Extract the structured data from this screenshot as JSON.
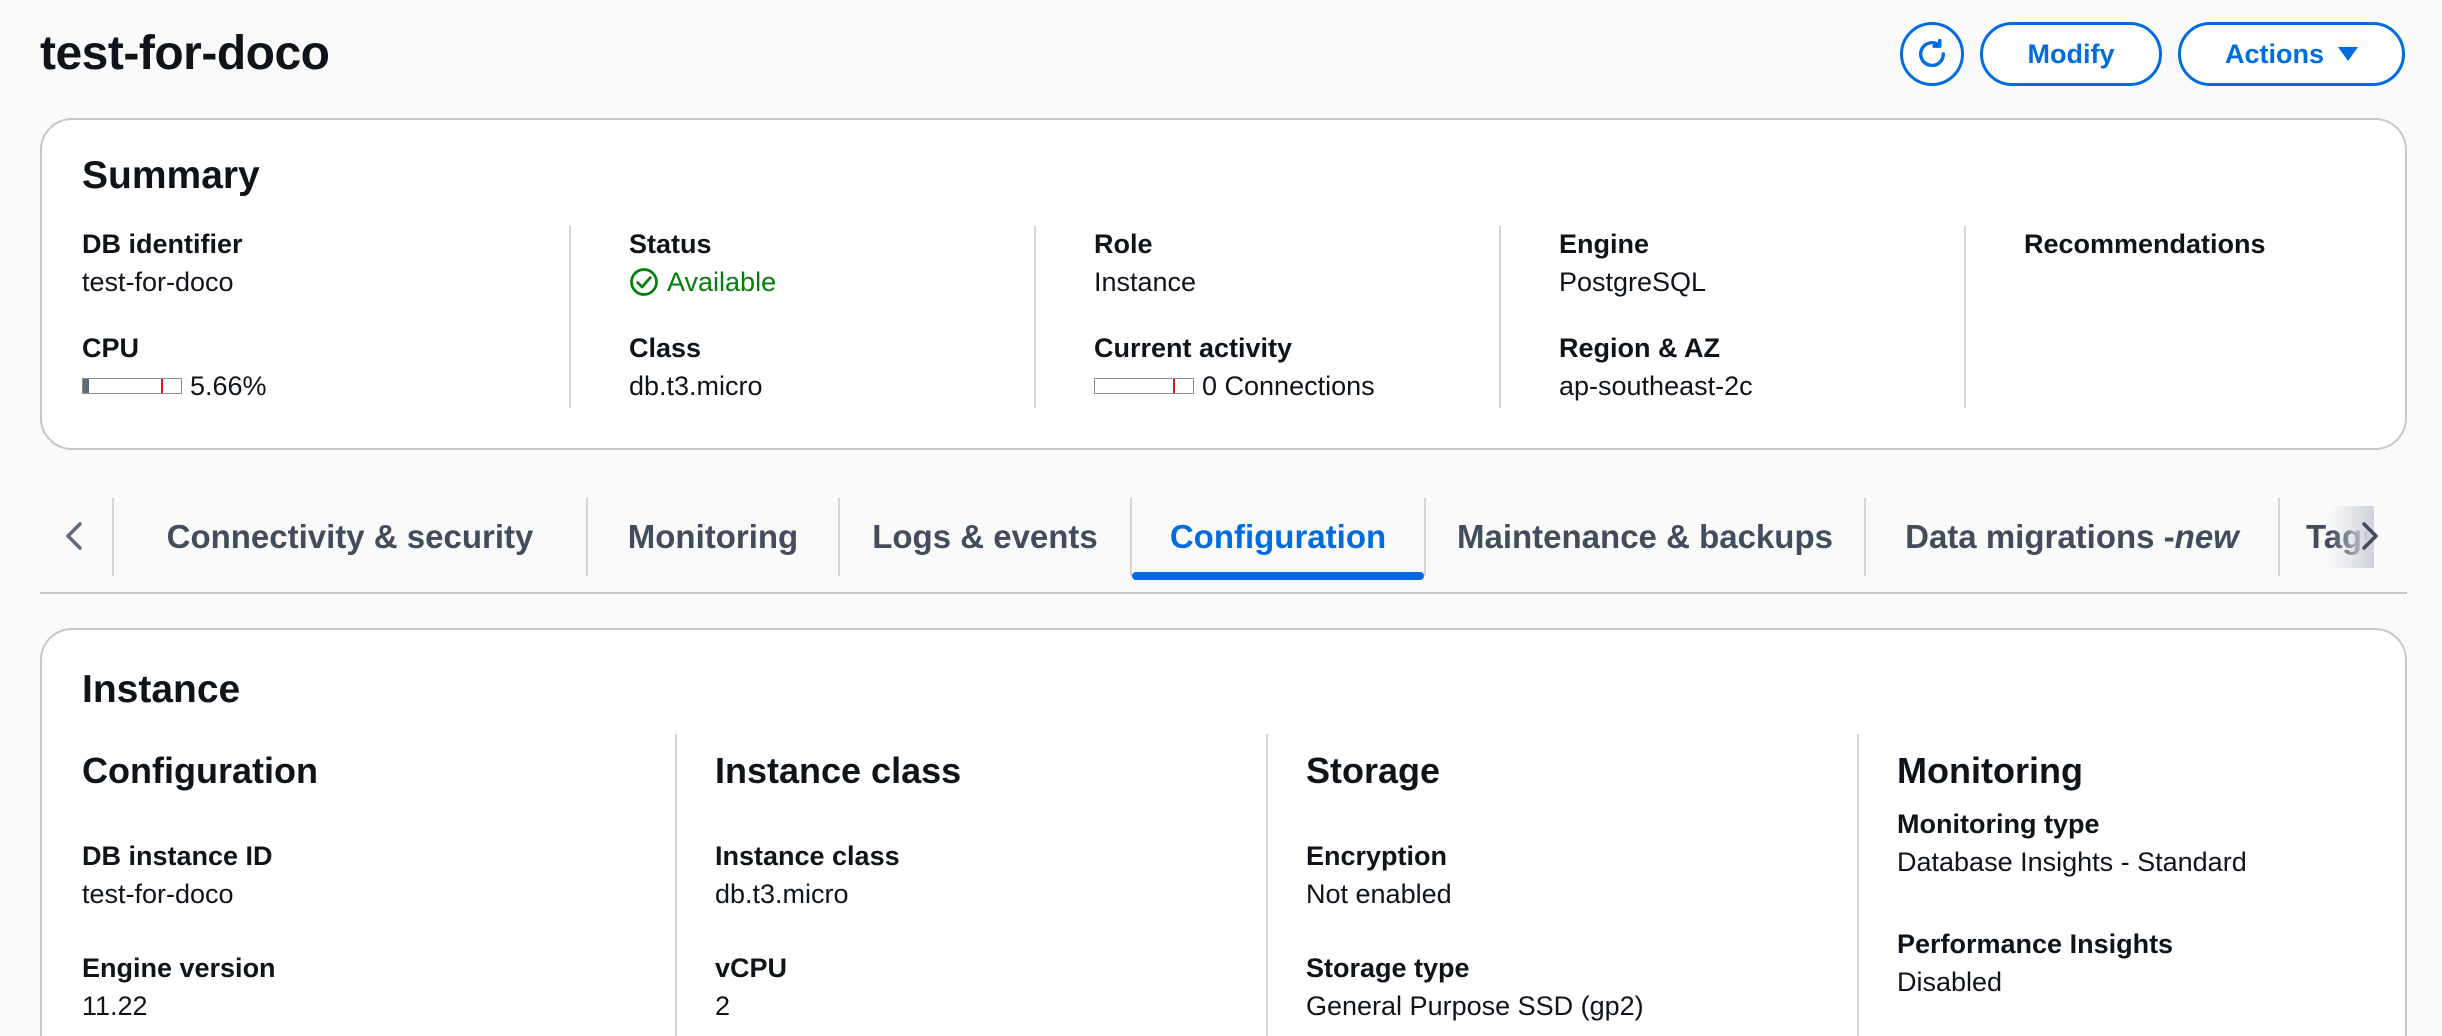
{
  "page": {
    "title": "test-for-doco"
  },
  "header": {
    "modify_label": "Modify",
    "actions_label": "Actions",
    "refresh_icon": "refresh-icon"
  },
  "summary": {
    "title": "Summary",
    "db_identifier": {
      "label": "DB identifier",
      "value": "test-for-doco"
    },
    "cpu": {
      "label": "CPU",
      "value": "5.66%",
      "fraction": 0.0566
    },
    "status": {
      "label": "Status",
      "value": "Available",
      "color": "#037f0c"
    },
    "class": {
      "label": "Class",
      "value": "db.t3.micro"
    },
    "role": {
      "label": "Role",
      "value": "Instance"
    },
    "current_activity": {
      "label": "Current activity",
      "value": "0 Connections",
      "fraction": 0
    },
    "engine": {
      "label": "Engine",
      "value": "PostgreSQL"
    },
    "region_az": {
      "label": "Region & AZ",
      "value": "ap-southeast-2c"
    },
    "recommendations": {
      "label": "Recommendations"
    }
  },
  "tabs": [
    {
      "label": "Connectivity & security"
    },
    {
      "label": "Monitoring"
    },
    {
      "label": "Logs & events"
    },
    {
      "label": "Configuration",
      "active": true
    },
    {
      "label": "Maintenance & backups"
    },
    {
      "label": "Data migrations - ",
      "suffix": "new"
    },
    {
      "label": "Tags"
    }
  ],
  "instance": {
    "title": "Instance",
    "configuration": {
      "title": "Configuration",
      "db_instance_id": {
        "label": "DB instance ID",
        "value": "test-for-doco"
      },
      "engine_version": {
        "label": "Engine version",
        "value": "11.22"
      }
    },
    "instance_class": {
      "title": "Instance class",
      "instance_class": {
        "label": "Instance class",
        "value": "db.t3.micro"
      },
      "vcpu": {
        "label": "vCPU",
        "value": "2"
      }
    },
    "storage": {
      "title": "Storage",
      "encryption": {
        "label": "Encryption",
        "value": "Not enabled"
      },
      "storage_type": {
        "label": "Storage type",
        "value": "General Purpose SSD (gp2)"
      }
    },
    "monitoring": {
      "title": "Monitoring",
      "monitoring_type": {
        "label": "Monitoring type",
        "value": "Database Insights - Standard"
      },
      "performance_insights": {
        "label": "Performance Insights",
        "value": "Disabled"
      }
    }
  },
  "colors": {
    "accent": "#006ce0",
    "success": "#037f0c",
    "text": "#0f141a",
    "tab_text": "#414d5c",
    "border": "#c6c6cd"
  }
}
